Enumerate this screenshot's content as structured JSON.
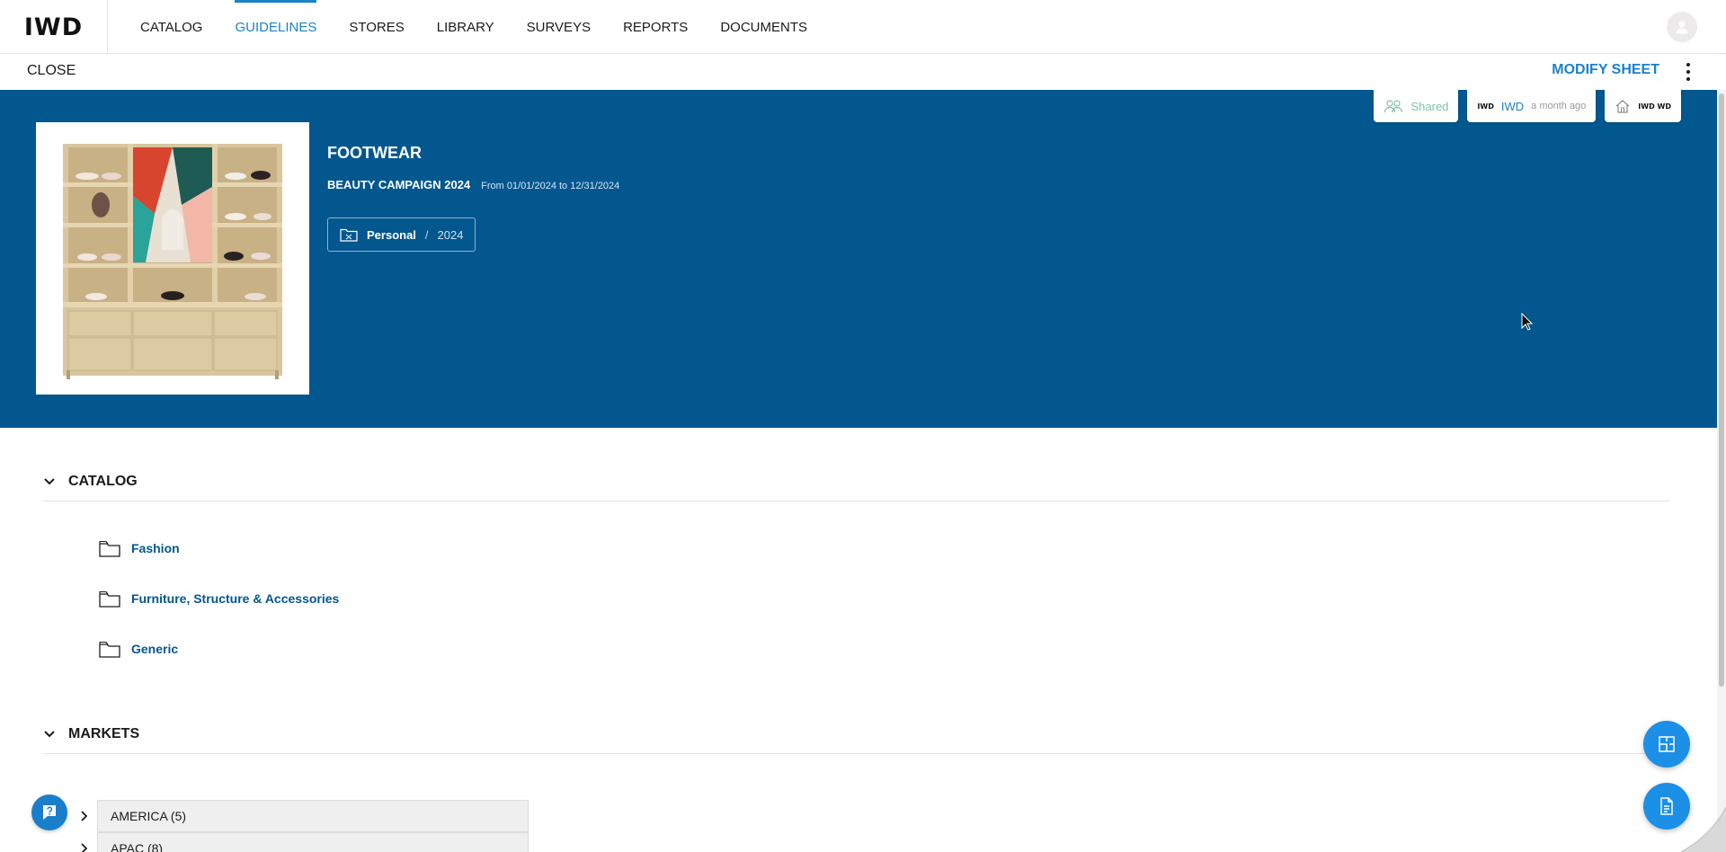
{
  "brand": {
    "logo_text": "IWD"
  },
  "nav": {
    "items": [
      {
        "label": "CATALOG",
        "active": false
      },
      {
        "label": "GUIDELINES",
        "active": true
      },
      {
        "label": "STORES",
        "active": false
      },
      {
        "label": "LIBRARY",
        "active": false
      },
      {
        "label": "SURVEYS",
        "active": false
      },
      {
        "label": "REPORTS",
        "active": false
      },
      {
        "label": "DOCUMENTS",
        "active": false
      }
    ]
  },
  "subbar": {
    "close_label": "CLOSE",
    "modify_label": "MODIFY SHEET",
    "more_icon": "more-vertical-icon"
  },
  "sheet": {
    "title": "FOOTWEAR",
    "campaign": "BEAUTY CAMPAIGN 2024",
    "dates": "From 01/01/2024 to 12/31/2024",
    "folder": {
      "name": "Personal",
      "separator": "/",
      "year": "2024",
      "icon": "folder-icon"
    },
    "tags": {
      "shared_label": "Shared",
      "author_logo": "IWD",
      "author_name": "IWD",
      "author_time": "a month ago",
      "store_logo": "IWD WD"
    }
  },
  "catalog": {
    "title": "CATALOG",
    "items": [
      {
        "label": "Fashion"
      },
      {
        "label": "Furniture, Structure & Accessories"
      },
      {
        "label": "Generic"
      }
    ]
  },
  "markets": {
    "title": "MARKETS",
    "items": [
      {
        "label": "AMERICA (5)"
      },
      {
        "label": "APAC (8)"
      }
    ]
  },
  "colors": {
    "hero_bg": "#02578f",
    "accent": "#1c82c8",
    "fab": "#1c8fe6",
    "shared": "#7cc3a6"
  }
}
